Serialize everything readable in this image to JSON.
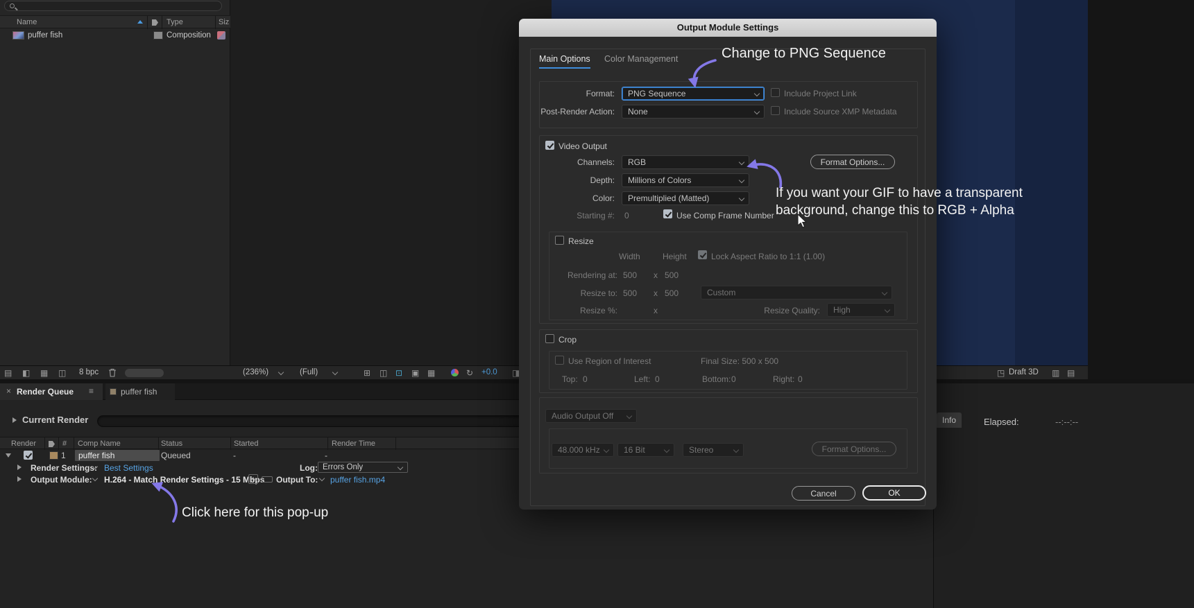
{
  "colors": {
    "accent_blue": "#3f8edd",
    "annotation_purple": "#8478e8",
    "link_blue": "#57a3e4",
    "dialog_bg": "#2b2b2b",
    "comp_navy": "#1b2a4b"
  },
  "project_panel": {
    "name_col": "Name",
    "type_col": "Type",
    "size_col": "Siz",
    "item_name": "puffer fish",
    "item_type": "Composition"
  },
  "footage_toolbar": {
    "bpc": "8 bpc",
    "zoom": "(236%)",
    "resolution": "(Full)",
    "exposure": "+0.0"
  },
  "comp_toolbar": {
    "draft_3d": "Draft 3D"
  },
  "render_queue": {
    "close": "×",
    "tab": "Render Queue",
    "menu": "≡",
    "comp_tab": "puffer fish",
    "current_render": "Current Render",
    "col_render": "Render",
    "col_num": "#",
    "col_comp": "Comp Name",
    "col_status": "Status",
    "col_started": "Started",
    "col_render_time": "Render Time",
    "row_num": "1",
    "row_comp": "puffer fish",
    "row_status": "Queued",
    "row_started": "-",
    "row_render_time": "-",
    "render_settings_label": "Render Settings:",
    "render_settings_value": "Best Settings",
    "log_label": "Log:",
    "log_value": "Errors Only",
    "output_module_label": "Output Module:",
    "output_module_value": "H.264 - Match Render Settings - 15 Mbps",
    "plus": "+",
    "output_to_label": "Output To:",
    "output_to_value": "puffer fish.mp4"
  },
  "info_panel": {
    "tab": "Info",
    "elapsed_label": "Elapsed:",
    "elapsed_value": "--:--:--"
  },
  "dialog": {
    "title": "Output Module Settings",
    "tab_main": "Main Options",
    "tab_color": "Color Management",
    "format_label": "Format:",
    "format_value": "PNG Sequence",
    "include_project_link": "Include Project Link",
    "post_render_label": "Post-Render Action:",
    "post_render_value": "None",
    "include_xmp": "Include Source XMP Metadata",
    "video_output": "Video Output",
    "channels_label": "Channels:",
    "channels_value": "RGB",
    "depth_label": "Depth:",
    "depth_value": "Millions of Colors",
    "color_label": "Color:",
    "color_value": "Premultiplied (Matted)",
    "starting_label": "Starting #:",
    "starting_value": "0",
    "use_comp_frame": "Use Comp Frame Number",
    "format_options": "Format Options...",
    "resize_label": "Resize",
    "width_col": "Width",
    "height_col": "Height",
    "lock_aspect": "Lock Aspect Ratio to 1:1 (1.00)",
    "rendering_at_label": "Rendering at:",
    "rendering_w": "500",
    "rendering_x": "x",
    "rendering_h": "500",
    "resize_to_label": "Resize to:",
    "resize_w": "500",
    "resize_x": "x",
    "resize_h": "500",
    "resize_preset": "Custom",
    "resize_pct_label": "Resize %:",
    "resize_pct_x": "x",
    "resize_quality_label": "Resize Quality:",
    "resize_quality_value": "High",
    "crop_label": "Crop",
    "use_roi": "Use Region of Interest",
    "final_size": "Final Size: 500 x 500",
    "top_label": "Top:",
    "top_value": "0",
    "left_label": "Left:",
    "left_value": "0",
    "bottom_label": "Bottom:",
    "bottom_value": "0",
    "right_label": "Right:",
    "right_value": "0",
    "audio_dropdown": "Audio Output Off",
    "sample_rate": "48.000 kHz",
    "bit_depth": "16 Bit",
    "channels_audio": "Stereo",
    "audio_format_options": "Format Options...",
    "cancel": "Cancel",
    "ok": "OK"
  },
  "annotations": {
    "png_note": "Change to PNG Sequence",
    "alpha_note_1": "If you want your GIF to have a transparent",
    "alpha_note_2": "background, change this to RGB + Alpha",
    "click_note": "Click here for this pop-up"
  }
}
